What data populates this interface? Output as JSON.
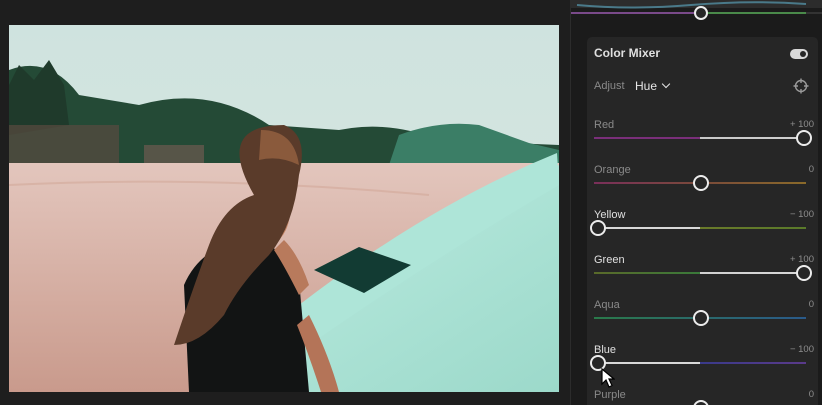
{
  "panel": {
    "title": "Color Mixer",
    "adjust_label": "Adjust",
    "adjust_value": "Hue",
    "toggle_on": true,
    "sliders": [
      {
        "name": "Red",
        "value": "+ 100",
        "level": 1.0,
        "active": false,
        "gradient": "linear-gradient(90deg,#7a2f7a,#7a2f7a 50%,#c8c8c8 50%,#d0d0d0)"
      },
      {
        "name": "Orange",
        "value": "0",
        "level": 0.5,
        "active": false,
        "gradient": "linear-gradient(90deg,#7a2f5a,#7a4a3a 50%,#8a6a2a 100%)"
      },
      {
        "name": "Yellow",
        "value": "− 100",
        "level": 0.0,
        "active": true,
        "gradient": "linear-gradient(90deg,#d8d8d8,#d8d8d8 50%,#6a7a2a 50%,#5a7a2a)"
      },
      {
        "name": "Green",
        "value": "+ 100",
        "level": 1.0,
        "active": true,
        "gradient": "linear-gradient(90deg,#5a6a2a,#3a7a3a 50%,#d0d0d0 50%,#d8d8d8)"
      },
      {
        "name": "Aqua",
        "value": "0",
        "level": 0.5,
        "active": false,
        "gradient": "linear-gradient(90deg,#2a7a4a,#2a6a6a 50%,#2a5a8a 100%)"
      },
      {
        "name": "Blue",
        "value": "− 100",
        "level": 0.0,
        "active": true,
        "gradient": "linear-gradient(90deg,#d8d8d8,#d8d8d8 50%,#3a3a8a 50%,#5a3a8a)"
      },
      {
        "name": "Purple",
        "value": "0",
        "level": 0.5,
        "active": false,
        "gradient": "linear-gradient(90deg,#4a3a8a,#7a3a7a)"
      }
    ]
  },
  "icons": {
    "toggle": "toggle-switch-icon",
    "dropdown": "chevron-down-icon",
    "target": "target-adjust-icon",
    "cursor": "mouse-pointer-icon"
  },
  "colors": {
    "label_active": "#e0e0e0",
    "label_inactive": "#8a8a8a"
  }
}
